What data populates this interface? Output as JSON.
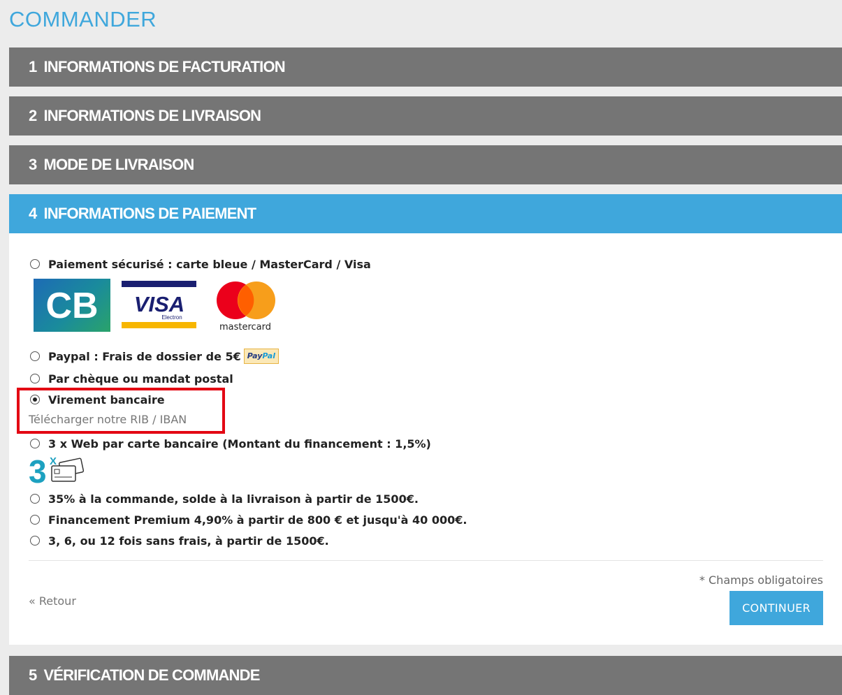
{
  "page_title": "COMMANDER",
  "steps": [
    {
      "num": "1",
      "label": "INFORMATIONS DE FACTURATION"
    },
    {
      "num": "2",
      "label": "INFORMATIONS DE LIVRAISON"
    },
    {
      "num": "3",
      "label": "MODE DE LIVRAISON"
    },
    {
      "num": "4",
      "label": "INFORMATIONS DE PAIEMENT"
    },
    {
      "num": "5",
      "label": "VÉRIFICATION DE COMMANDE"
    }
  ],
  "payment": {
    "options": [
      {
        "label": "Paiement sécurisé : carte bleue / MasterCard / Visa",
        "checked": false
      },
      {
        "label": "Paypal : Frais de dossier de 5€",
        "checked": false
      },
      {
        "label": "Par chèque ou mandat postal",
        "checked": false
      },
      {
        "label": "Virement bancaire",
        "checked": true
      },
      {
        "label": "3 x Web par carte bancaire (Montant du financement : 1,5%)",
        "checked": false
      },
      {
        "label": "35% à la commande, solde à la livraison à partir de 1500€.",
        "checked": false
      },
      {
        "label": "Financement Premium 4,90% à partir de 800 € et jusqu'à 40 000€.",
        "checked": false
      },
      {
        "label": "3, 6, ou 12 fois sans frais, à partir de 1500€.",
        "checked": false
      }
    ],
    "rib_link": "Télécharger notre RIB / IBAN",
    "logos": {
      "cb": "CB",
      "visa": "VISA",
      "visa_sub": "Electron",
      "mastercard": "mastercard",
      "paypal_a": "Pay",
      "paypal_b": "Pal",
      "three_x": "3",
      "three_x_sup": "X"
    }
  },
  "footer": {
    "required_note": "* Champs obligatoires",
    "back": "« Retour",
    "continue": "CONTINUER"
  },
  "colors": {
    "accent": "#3fa7dc",
    "step_inactive": "#757575",
    "highlight": "#e30613"
  }
}
